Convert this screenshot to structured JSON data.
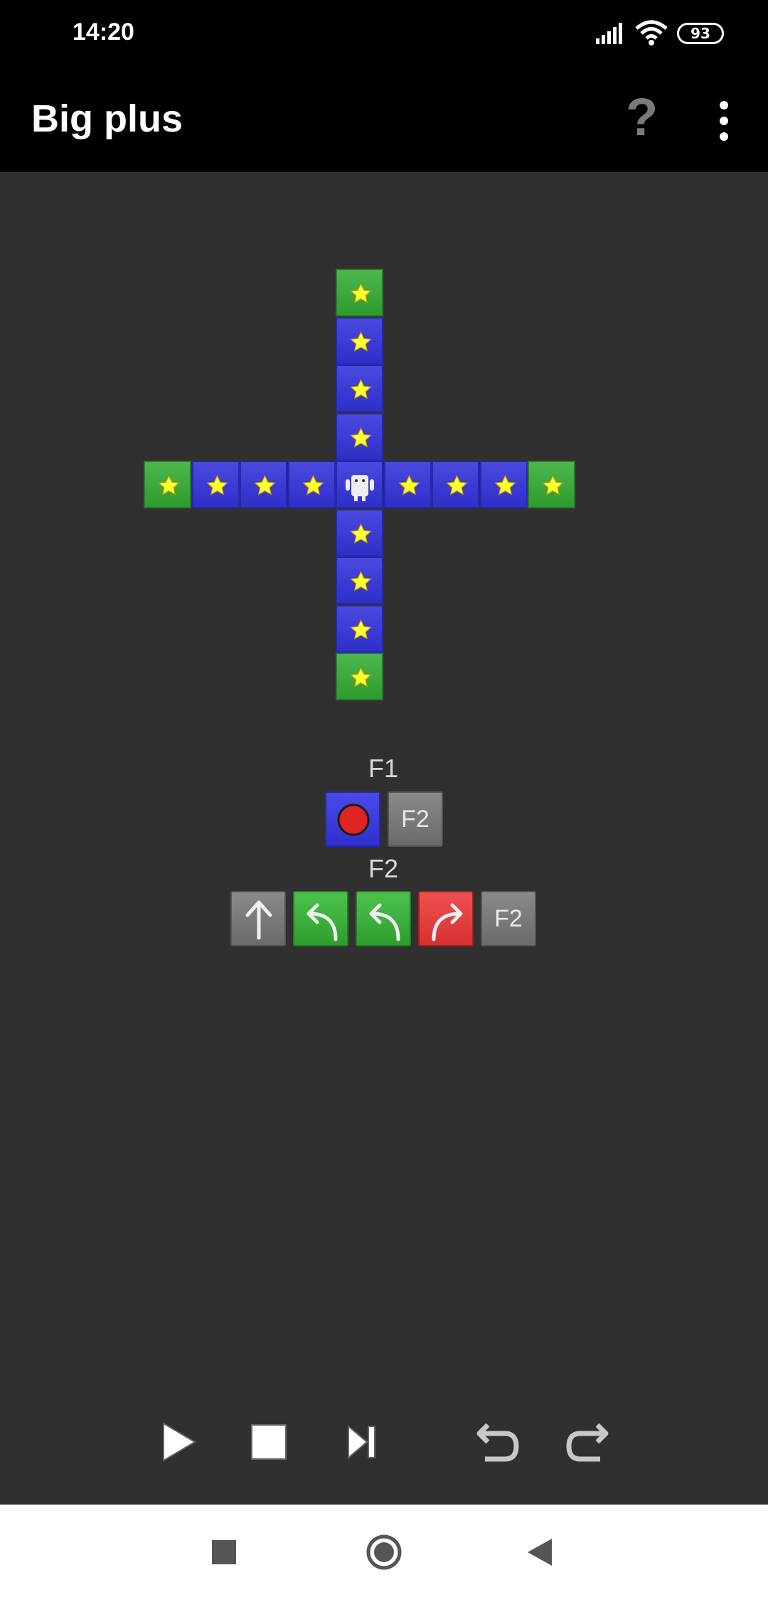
{
  "status_bar": {
    "time": "14:20",
    "battery": "93"
  },
  "app_bar": {
    "title": "Big plus",
    "help_label": "?"
  },
  "board": {
    "tile_colors": {
      "blue": "#3a3ad8",
      "green": "#3aa83a",
      "star": "#ffff30"
    },
    "robot_icon": "robot-icon",
    "star_icon": "star-icon"
  },
  "functions": [
    {
      "label": "F1",
      "slots": [
        {
          "kind": "record",
          "color": "blue"
        },
        {
          "kind": "call",
          "text": "F2",
          "color": "gray"
        }
      ]
    },
    {
      "label": "F2",
      "slots": [
        {
          "kind": "forward",
          "color": "gray"
        },
        {
          "kind": "turn-left",
          "color": "green"
        },
        {
          "kind": "turn-left",
          "color": "green"
        },
        {
          "kind": "turn-right",
          "color": "red"
        },
        {
          "kind": "call",
          "text": "F2",
          "color": "gray"
        }
      ]
    }
  ],
  "controls": [
    "play-icon",
    "stop-icon",
    "step-icon",
    "undo-icon",
    "redo-icon"
  ],
  "nav": [
    "recents-icon",
    "home-icon",
    "back-icon"
  ]
}
